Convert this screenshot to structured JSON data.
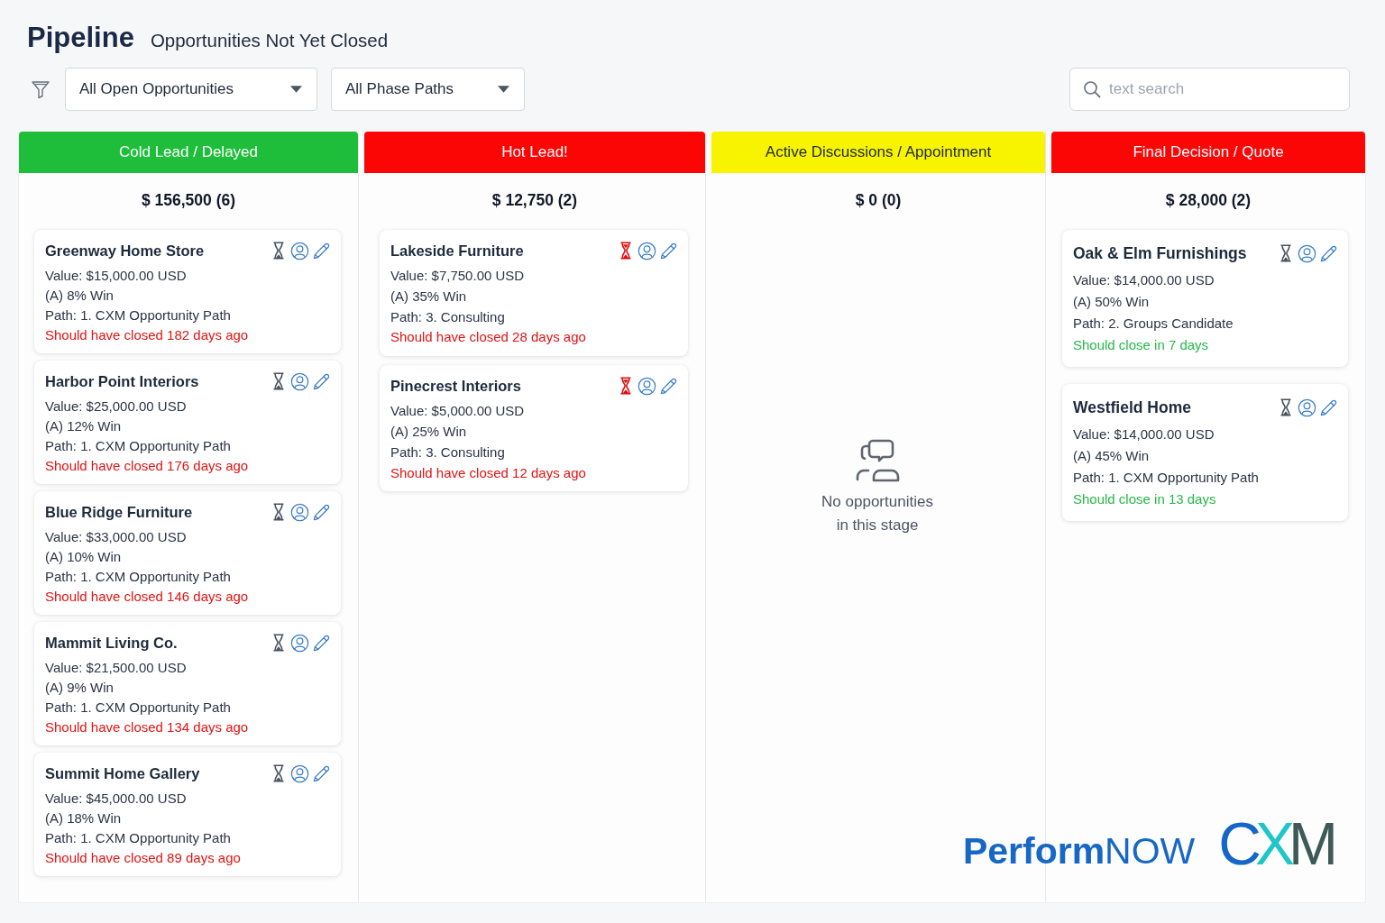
{
  "header": {
    "title": "Pipeline",
    "subtitle": "Opportunities Not Yet Closed"
  },
  "filters": {
    "dropdowns": [
      {
        "value": "All Open Opportunities"
      },
      {
        "value": "All Phase Paths"
      }
    ],
    "search": {
      "placeholder": "text search"
    }
  },
  "columns": [
    {
      "title": "Cold Lead / Delayed",
      "color": "#1ebe3a",
      "total": "$ 156,500 (6)",
      "cards": [
        {
          "name": "Greenway Home Store",
          "value": "Value: $15,000.00 USD",
          "win": "(A) 8% Win",
          "path": "Path: 1. CXM Opportunity Path",
          "due": "Should have closed 182 days ago",
          "overdue": true,
          "timer_alert": false
        },
        {
          "name": "Harbor Point Interiors",
          "value": "Value: $25,000.00 USD",
          "win": "(A) 12% Win",
          "path": "Path: 1. CXM Opportunity Path",
          "due": "Should have closed 176 days ago",
          "overdue": true,
          "timer_alert": false
        },
        {
          "name": "Blue Ridge Furniture",
          "value": "Value: $33,000.00 USD",
          "win": "(A) 10% Win",
          "path": "Path: 1. CXM Opportunity Path",
          "due": "Should have closed 146 days ago",
          "overdue": true,
          "timer_alert": false
        },
        {
          "name": "Mammit Living Co.",
          "value": "Value: $21,500.00 USD",
          "win": "(A) 9% Win",
          "path": "Path: 1. CXM Opportunity Path",
          "due": "Should have closed 134 days ago",
          "overdue": true,
          "timer_alert": false
        },
        {
          "name": "Summit Home Gallery",
          "value": "Value: $45,000.00 USD",
          "win": "(A) 18% Win",
          "path": "Path: 1. CXM Opportunity Path",
          "due": "Should have closed 89 days ago",
          "overdue": true,
          "timer_alert": false
        }
      ]
    },
    {
      "title": "Hot Lead!",
      "color": "#fb0505",
      "total": "$ 12,750 (2)",
      "cards": [
        {
          "name": "Lakeside Furniture",
          "value": "Value: $7,750.00 USD",
          "win": "(A) 35% Win",
          "path": "Path: 3. Consulting",
          "due": "Should have closed 28 days ago",
          "overdue": true,
          "timer_alert": true
        },
        {
          "name": "Pinecrest Interiors",
          "value": "Value: $5,000.00 USD",
          "win": "(A) 25% Win",
          "path": "Path: 3. Consulting",
          "due": "Should have closed 12 days ago",
          "overdue": true,
          "timer_alert": true
        }
      ]
    },
    {
      "title": "Active Discussions / Appointment",
      "color": "#f8f400",
      "total": "$ 0 (0)",
      "empty_message": "No opportunities in this stage"
    },
    {
      "title": "Final Decision / Quote",
      "color": "#fb0505",
      "total": "$ 28,000 (2)",
      "cards": [
        {
          "name": "Oak & Elm Furnishings",
          "value": "Value: $14,000.00 USD",
          "win": "(A) 50% Win",
          "path": "Path: 2. Groups Candidate",
          "due": "Should close in 7 days",
          "overdue": false,
          "timer_alert": false
        },
        {
          "name": "Westfield Home",
          "value": "Value: $14,000.00 USD",
          "win": "(A) 45% Win",
          "path": "Path: 1. CXM Opportunity Path",
          "due": "Should close in 13 days",
          "overdue": false,
          "timer_alert": false
        }
      ]
    }
  ],
  "logo": {
    "wordmark": "**Perform**NOW",
    "mark": "CXM"
  }
}
